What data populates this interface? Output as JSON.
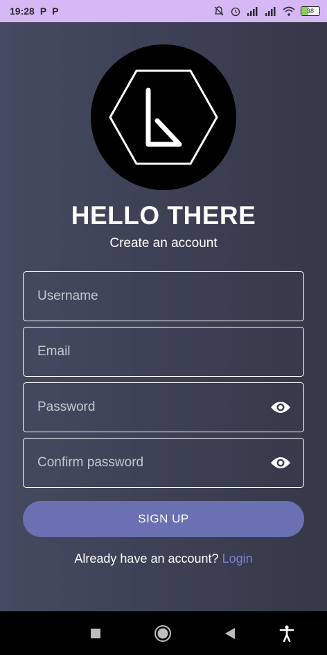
{
  "status_bar": {
    "time": "19:28",
    "left_icons": [
      "P",
      "P"
    ],
    "right_icons": [
      "mute-bell-icon",
      "alarm-icon",
      "signal-icon",
      "signal-icon",
      "wifi-icon"
    ],
    "battery": "38"
  },
  "logo": {
    "letter": "k",
    "shape": "hexagon"
  },
  "header": {
    "title": "HELLO THERE",
    "subtitle": "Create an account"
  },
  "form": {
    "username_placeholder": "Username",
    "email_placeholder": "Email",
    "password_placeholder": "Password",
    "confirm_password_placeholder": "Confirm password",
    "signup_label": "SIGN UP"
  },
  "footer": {
    "prompt": "Already have an account?",
    "login_link": "Login"
  },
  "nav_bar": {
    "icons": [
      "recents-square-icon",
      "home-circle-icon",
      "back-triangle-icon",
      "accessibility-icon"
    ]
  },
  "colors": {
    "status_bar": "#d6b8f4",
    "background": "#3b3e50",
    "accent": "#6a70b2",
    "link": "#7b82cf"
  }
}
